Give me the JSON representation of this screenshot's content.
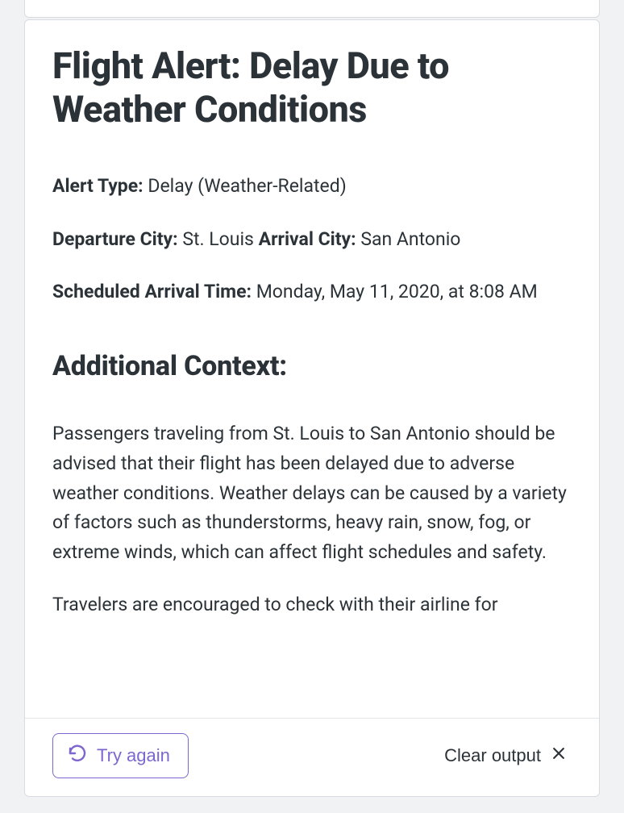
{
  "title": "Flight Alert: Delay Due to Weather Conditions",
  "labels": {
    "alert_type": "Alert Type:",
    "departure_city": "Departure City:",
    "arrival_city": "Arrival City:",
    "scheduled_arrival": "Scheduled Arrival Time:"
  },
  "values": {
    "alert_type": "Delay (Weather-Related)",
    "departure_city": "St. Louis",
    "arrival_city": "San Antonio",
    "scheduled_arrival": "Monday, May 11, 2020, at 8:08 AM"
  },
  "context_heading": "Additional Context:",
  "paragraph1": "Passengers traveling from St. Louis to San Antonio should be advised that their flight has been delayed due to adverse weather conditions. Weather delays can be caused by a variety of factors such as thunderstorms, heavy rain, snow, fog, or extreme winds, which can affect flight schedules and safety.",
  "paragraph2": "Travelers are encouraged to check with their airline for",
  "footer": {
    "try_again": "Try again",
    "clear": "Clear output"
  }
}
